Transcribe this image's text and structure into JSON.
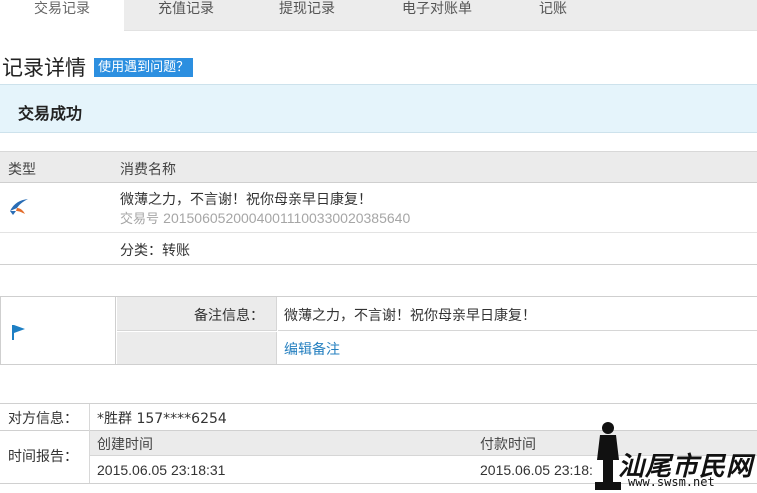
{
  "tabs": [
    {
      "label": "交易记录",
      "active": true
    },
    {
      "label": "充值记录",
      "active": false
    },
    {
      "label": "提现记录",
      "active": false
    },
    {
      "label": "电子对账单",
      "active": false
    },
    {
      "label": "记账",
      "active": false
    }
  ],
  "heading": {
    "title": "记录详情",
    "help_link": "使用遇到问题？"
  },
  "status": {
    "text": "交易成功",
    "bg_color": "#e5f4fb"
  },
  "detail": {
    "col_type": "类型",
    "col_name": "消费名称",
    "goods_name": "微薄之力，不言谢！祝你母亲早日康复！",
    "trade_no_label": "交易号",
    "trade_no": "20150605200040011100330020385640",
    "category": "分类：转账",
    "type_icon": "transfer-bird-icon"
  },
  "memo": {
    "label": "备注信息：",
    "value": "微薄之力，不言谢！祝你母亲早日康复！",
    "edit_link": "编辑备注",
    "icon": "flag-icon",
    "link_color": "#2680c0"
  },
  "counterparty": {
    "label": "对方信息：",
    "value": "*胜群 157****6254"
  },
  "time_report": {
    "label": "时间报告：",
    "created_label": "创建时间",
    "created_value": "2015.06.05 23:18:31",
    "paid_label": "付款时间",
    "paid_value": "2015.06.05 23:18:"
  },
  "watermark": {
    "text": "汕尾市民网",
    "url": "www.swsm.net"
  }
}
